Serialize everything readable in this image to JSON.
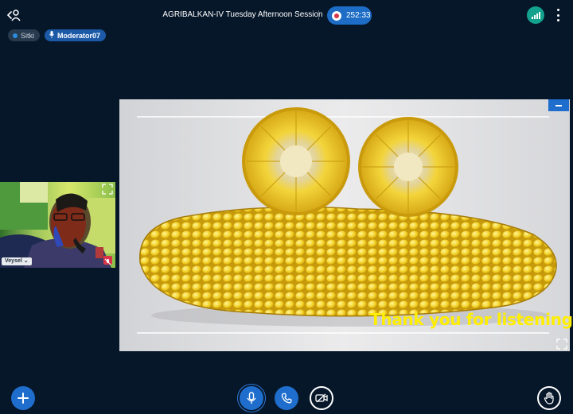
{
  "header": {
    "session_title": "AGRIBALKAN-IV Tuesday Afternoon Session",
    "recording_time": "252:33",
    "icons": {
      "leave": "leave-meeting-icon",
      "record": "record-icon",
      "connection": "connection-status-icon",
      "more": "more-options-icon"
    }
  },
  "users": [
    {
      "name": "Sitki",
      "role": "viewer",
      "icon": "status-dot-icon"
    },
    {
      "name": "Moderator07",
      "role": "presenter",
      "icon": "microphone-icon"
    }
  ],
  "webcam": {
    "username": "Veysel",
    "icons": {
      "expand": "expand-icon",
      "muted": "mic-muted-icon"
    }
  },
  "presentation": {
    "slide_caption": "Thank you for listening",
    "icons": {
      "minimize": "minimize-icon",
      "fullscreen": "fullscreen-icon"
    }
  },
  "controls": {
    "actions": "plus-icon",
    "microphone": "microphone-icon",
    "audio": "phone-icon",
    "video": "video-off-icon",
    "raise_hand": "hand-icon"
  },
  "colors": {
    "background": "#06172a",
    "accent": "#1f6ecd",
    "connection": "#13a28e",
    "caption": "#ffee00",
    "recording": "#d9364a"
  }
}
